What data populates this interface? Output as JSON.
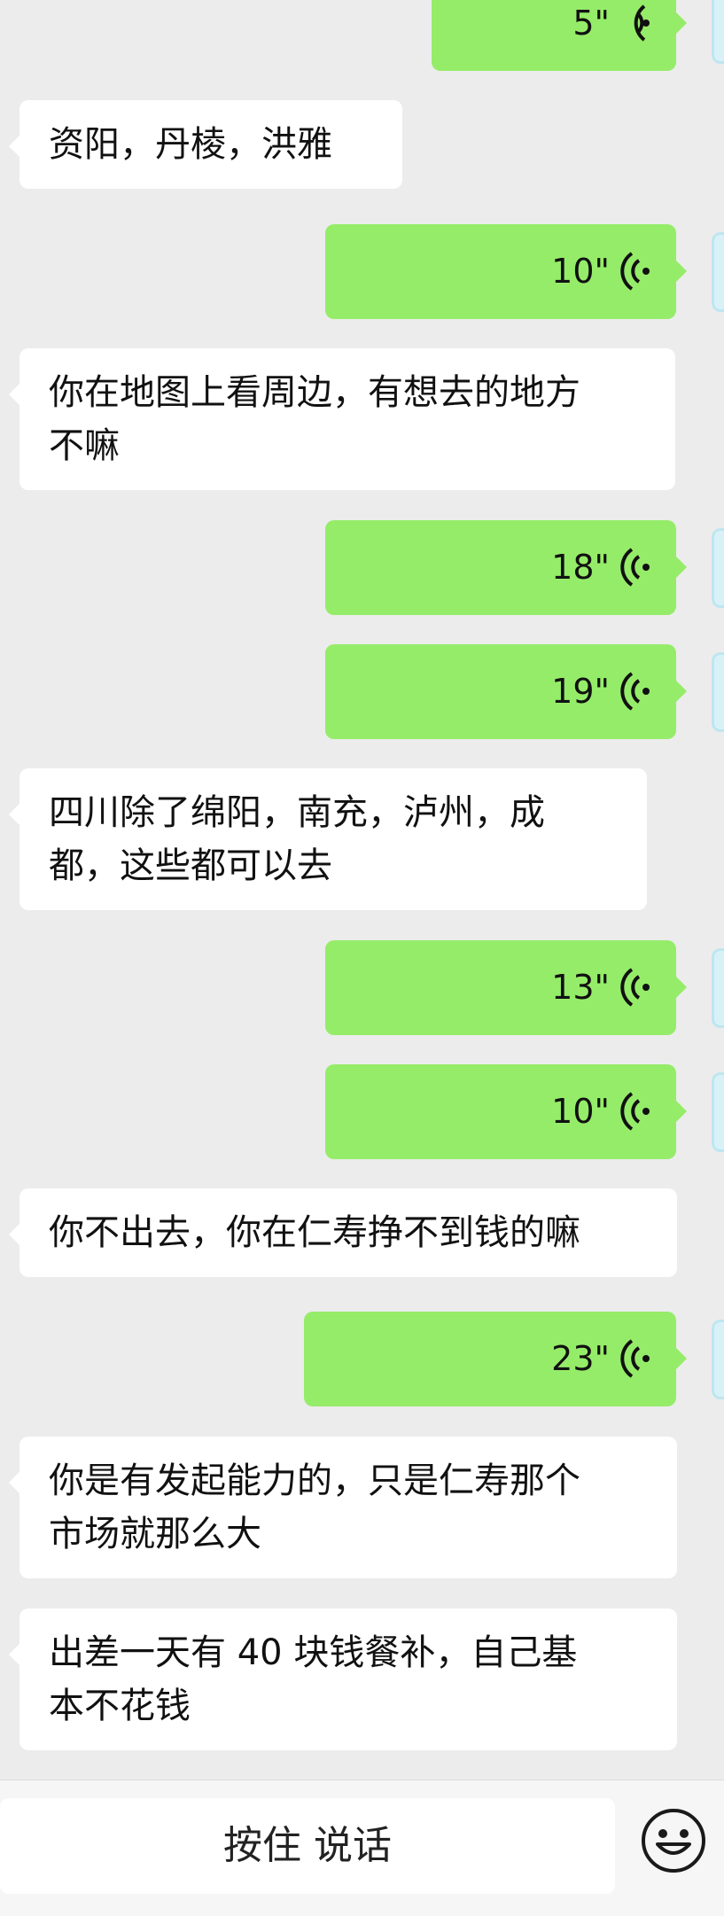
{
  "messages": [
    {
      "id": "m1",
      "side": "out",
      "type": "voice",
      "duration": "5\""
    },
    {
      "id": "m2",
      "side": "in",
      "type": "text",
      "lines": [
        "资阳，丹棱，洪雅"
      ]
    },
    {
      "id": "m3",
      "side": "out",
      "type": "voice",
      "duration": "10\""
    },
    {
      "id": "m4",
      "side": "in",
      "type": "text",
      "lines": [
        "你在地图上看周边，有想去的地方",
        "不嘛"
      ]
    },
    {
      "id": "m5",
      "side": "out",
      "type": "voice",
      "duration": "18\""
    },
    {
      "id": "m6",
      "side": "out",
      "type": "voice",
      "duration": "19\""
    },
    {
      "id": "m7",
      "side": "in",
      "type": "text",
      "lines": [
        "四川除了绵阳，南充，泸州，成",
        "都，这些都可以去"
      ]
    },
    {
      "id": "m8",
      "side": "out",
      "type": "voice",
      "duration": "13\""
    },
    {
      "id": "m9",
      "side": "out",
      "type": "voice",
      "duration": "10\""
    },
    {
      "id": "m10",
      "side": "in",
      "type": "text",
      "lines": [
        "你不出去，你在仁寿挣不到钱的嘛"
      ]
    },
    {
      "id": "m11",
      "side": "out",
      "type": "voice",
      "duration": "23\""
    },
    {
      "id": "m12",
      "side": "in",
      "type": "text",
      "lines": [
        "你是有发起能力的，只是仁寿那个",
        "市场就那么大"
      ]
    },
    {
      "id": "m13",
      "side": "in",
      "type": "text",
      "lines": [
        "出差一天有 40 块钱餐补，自己基",
        "本不花钱"
      ]
    }
  ],
  "input_bar": {
    "hold_to_talk_label": "按住 说话",
    "emoji_icon": "smiley-face-icon"
  },
  "colors": {
    "background": "#ececec",
    "outgoing_bubble": "#95ec69",
    "incoming_bubble": "#ffffff"
  }
}
